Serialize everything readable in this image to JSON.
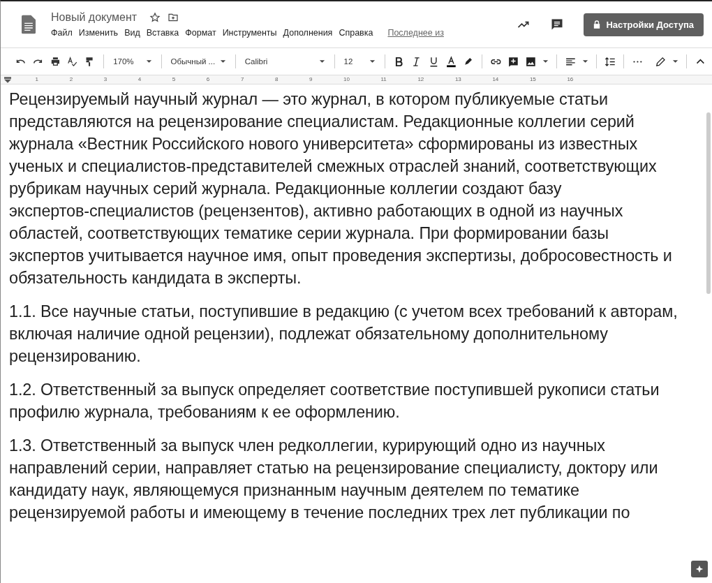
{
  "document": {
    "title": "Новый документ"
  },
  "menu": [
    "Файл",
    "Изменить",
    "Вид",
    "Вставка",
    "Формат",
    "Инструменты",
    "Дополнения",
    "Справка"
  ],
  "last_edit": "Последнее из",
  "share_button": "Настройки Доступа",
  "toolbar": {
    "zoom": "170%",
    "style": "Обычный ...",
    "font": "Calibri",
    "size": "12"
  },
  "ruler": [
    "1",
    "2",
    "3",
    "4",
    "5",
    "6",
    "7",
    "8",
    "9",
    "10",
    "11",
    "12",
    "13",
    "14",
    "15",
    "16"
  ],
  "paragraphs": [
    {
      "lines": [
        "Рецензируемый научный журнал — это журнал, в котором публикуемые статьи",
        "представляются на рецензирование специалистам. Редакционные коллегии серий",
        "журнала «Вестник Российского нового университета» сформированы из известных",
        "ученых и специалистов-представителей смежных отраслей знаний, соответствующих",
        "рубрикам научных серий журнала. Редакционные коллегии создают базу",
        "экспертов-специалистов (рецензентов), активно работающих в одной из научных",
        "областей, соответствующих тематике серии журнала. При формировании базы",
        "экспертов учитывается научное имя, опыт проведения экспертизы, добросовестность и",
        "обязательность кандидата в эксперты."
      ]
    },
    {
      "lines": [
        "1.1. Все научные статьи, поступившие в редакцию (с учетом всех требований к авторам,",
        "включая наличие одной рецензии), подлежат обязательному дополнительному",
        "рецензированию."
      ]
    },
    {
      "lines": [
        "1.2. Ответственный за выпуск определяет соответствие поступившей рукописи статьи",
        "профилю журнала, требованиям к ее оформлению."
      ]
    },
    {
      "lines": [
        "1.3. Ответственный за выпуск член редколлегии, курирующий одно из научных",
        "направлений серии, направляет статью на рецензирование специалисту, доктору или",
        "кандидату наук, являющемуся признанным научным деятелем по тематике",
        "рецензируемой работы и имеющему в течение последних трех лет публикации по"
      ]
    }
  ]
}
